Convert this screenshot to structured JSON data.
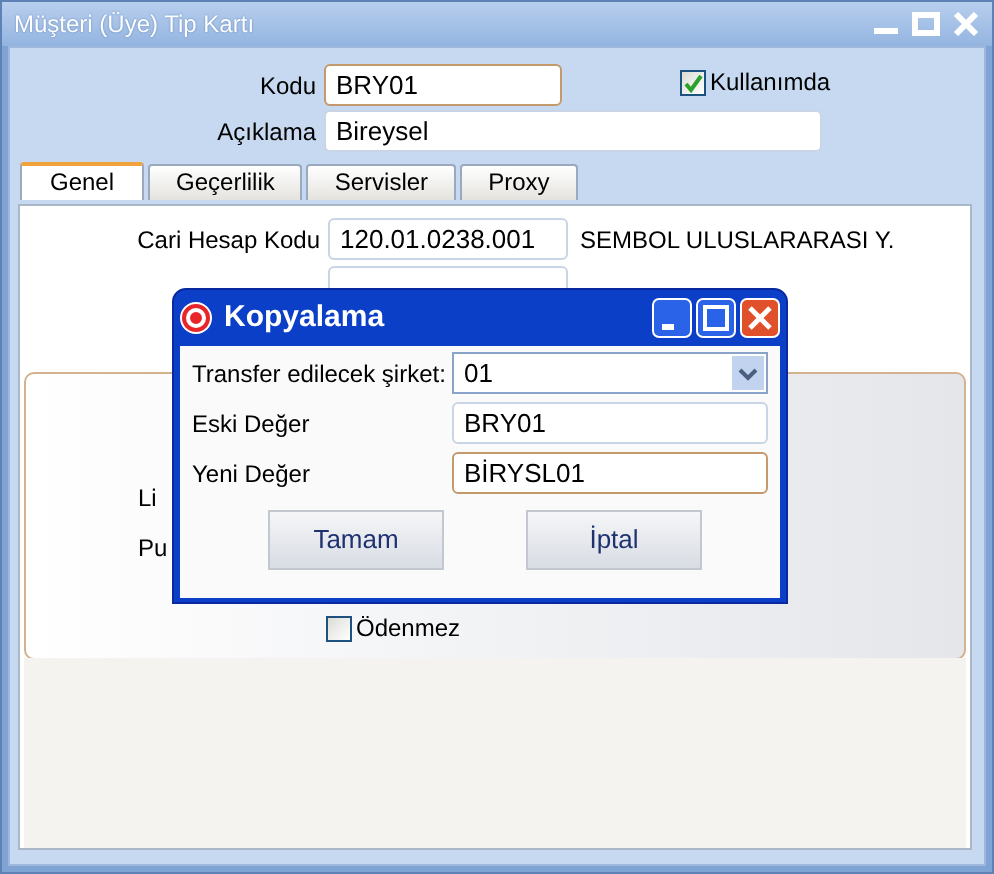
{
  "window": {
    "title": "Müşteri (Üye) Tip Kartı"
  },
  "header": {
    "code_label": "Kodu",
    "code_value": "BRY01",
    "in_use": {
      "label": "Kullanımda",
      "checked": true
    },
    "desc_label": "Açıklama",
    "desc_value": "Bireysel"
  },
  "tabs": [
    {
      "label": "Genel",
      "selected": true
    },
    {
      "label": "Geçerlilik",
      "selected": false
    },
    {
      "label": "Servisler",
      "selected": false
    },
    {
      "label": "Proxy",
      "selected": false
    }
  ],
  "general": {
    "account_label": "Cari Hesap Kodu",
    "account_value": "120.01.0238.001",
    "account_name": "SEMBOL ULUSLARARASI Y.",
    "partial_labels": [
      "Li",
      "Pu"
    ],
    "unpaid": {
      "label": "Ödenmez",
      "checked": false
    }
  },
  "dialog": {
    "title": "Kopyalama",
    "fields": [
      {
        "kind": "combo",
        "label": "Transfer edilecek şirket:",
        "value": "01",
        "focused": false
      },
      {
        "kind": "text",
        "label": "Eski Değer",
        "value": "BRY01",
        "focused": false
      },
      {
        "kind": "text",
        "label": "Yeni Değer",
        "value": "BİRYSL01",
        "focused": true
      }
    ],
    "buttons": [
      "Tamam",
      "İptal"
    ]
  }
}
